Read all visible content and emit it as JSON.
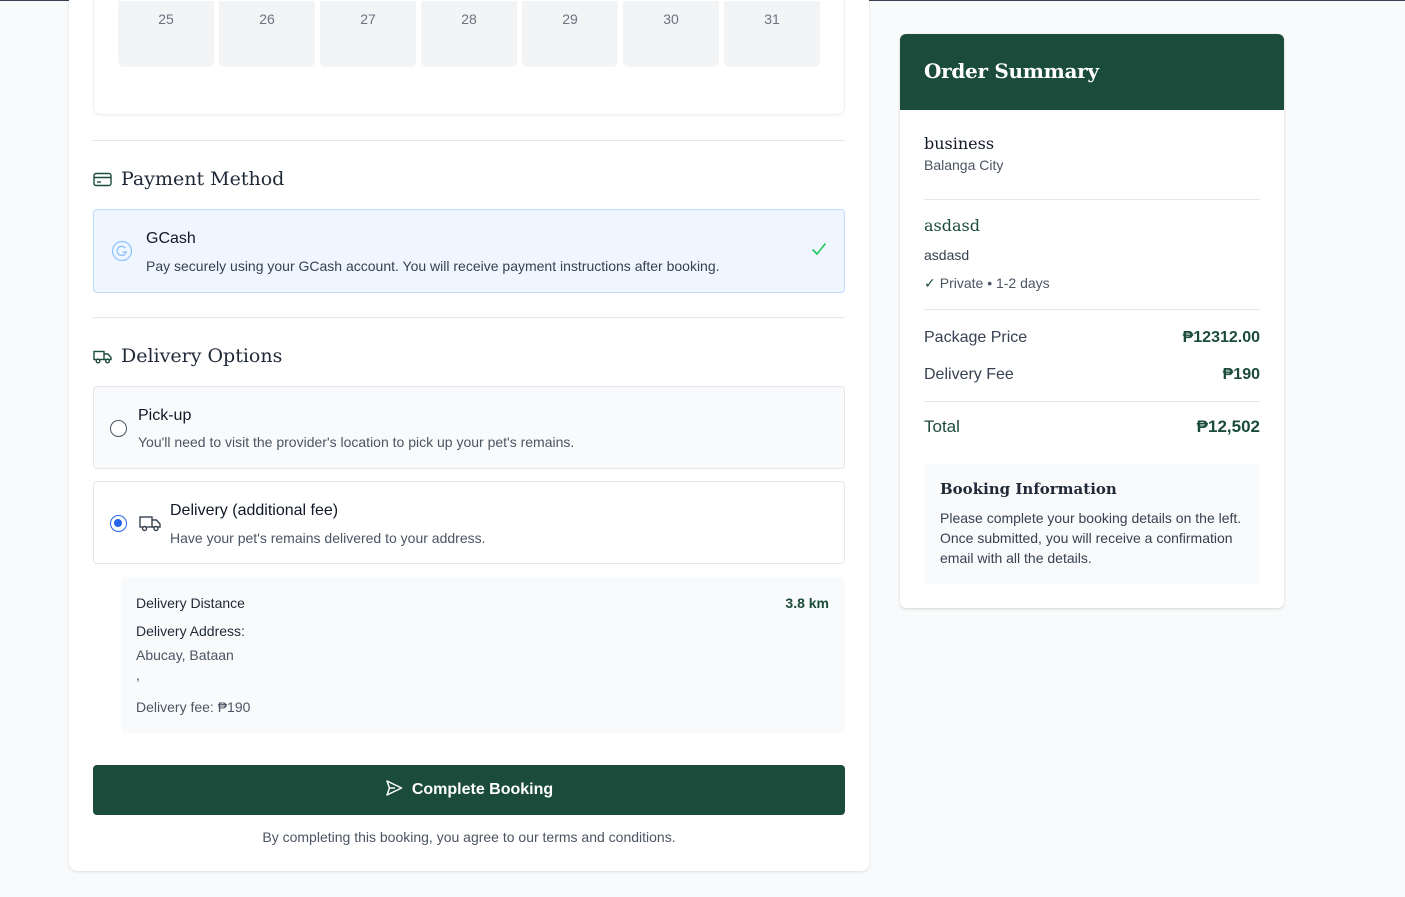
{
  "calendar": {
    "days": [
      "25",
      "26",
      "27",
      "28",
      "29",
      "30",
      "31"
    ]
  },
  "payment": {
    "section_title": "Payment Method",
    "method_title": "GCash",
    "method_description": "Pay securely using your GCash account. You will receive payment instructions after booking.",
    "selected": true
  },
  "delivery": {
    "section_title": "Delivery Options",
    "options": [
      {
        "title": "Pick-up",
        "description": "You'll need to visit the provider's location to pick up your pet's remains.",
        "selected": false
      },
      {
        "title": "Delivery (additional fee)",
        "description": "Have your pet's remains delivered to your address.",
        "selected": true
      }
    ],
    "distance_label": "Delivery Distance",
    "distance_value": "3.8 km",
    "address_label": "Delivery Address:",
    "address_line1": "Abucay, Bataan",
    "address_line2": ",",
    "fee_line": "Delivery fee: ₱190"
  },
  "actions": {
    "complete_label": "Complete Booking",
    "terms_text": "By completing this booking, you agree to our terms and conditions."
  },
  "summary": {
    "title": "Order Summary",
    "business_name": "business",
    "business_city": "Balanga City",
    "package_name": "asdasd",
    "package_description": "asdasd",
    "package_meta": "Private • 1-2 days",
    "package_price_label": "Package Price",
    "package_price_value": "₱12312.00",
    "delivery_fee_label": "Delivery Fee",
    "delivery_fee_value": "₱190",
    "total_label": "Total",
    "total_value": "₱12,502",
    "info_title": "Booking Information",
    "info_text": "Please complete your booking details on the left. Once submitted, you will receive a confirmation email with all the details."
  },
  "colors": {
    "brand": "#1b4b3b",
    "accent_blue": "#2563eb",
    "check_green": "#22c55e"
  }
}
